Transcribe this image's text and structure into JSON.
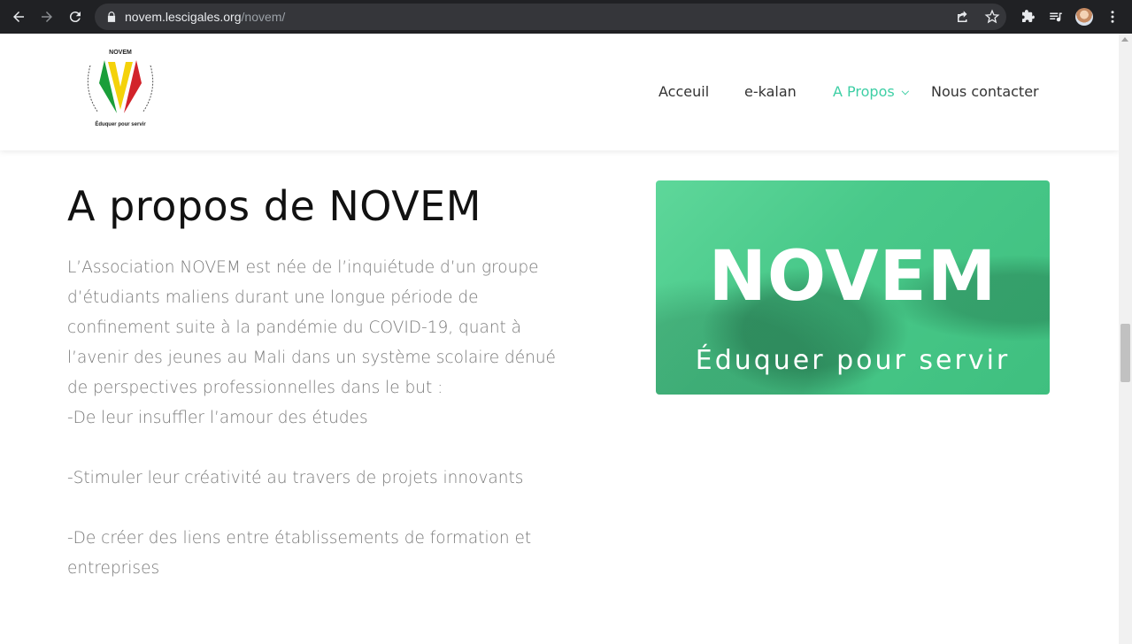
{
  "browser": {
    "url_domain": "novem.lescigales.org",
    "url_path": "/novem/"
  },
  "logo": {
    "top_text": "NOVEM",
    "bottom_text": "Éduquer pour servir",
    "colors": {
      "green": "#1a9e3a",
      "yellow": "#f4d20a",
      "red": "#d2232a"
    }
  },
  "nav": {
    "items": [
      {
        "label": "Acceuil"
      },
      {
        "label": "e-kalan"
      },
      {
        "label": "A Propos"
      },
      {
        "label": "Nous contacter"
      }
    ],
    "active_color": "#3ecfa5"
  },
  "content": {
    "title": "A propos de NOVEM",
    "intro": "L’Association NOVEM est née de l’inquiétude d’un groupe d’étudiants maliens durant une longue période de confinement suite à la pandémie du COVID-19, quant à l’avenir des jeunes au Mali dans un système scolaire dénué de perspectives professionnelles dans le but :",
    "points": [
      "-De leur insuffler l’amour des études",
      "-Stimuler leur créativité au travers de projets innovants",
      "-De créer des liens entre établissements de formation et entreprises"
    ]
  },
  "hero": {
    "title": "NOVEM",
    "subtitle": "Éduquer pour servir",
    "color": "#4ccb8c"
  }
}
